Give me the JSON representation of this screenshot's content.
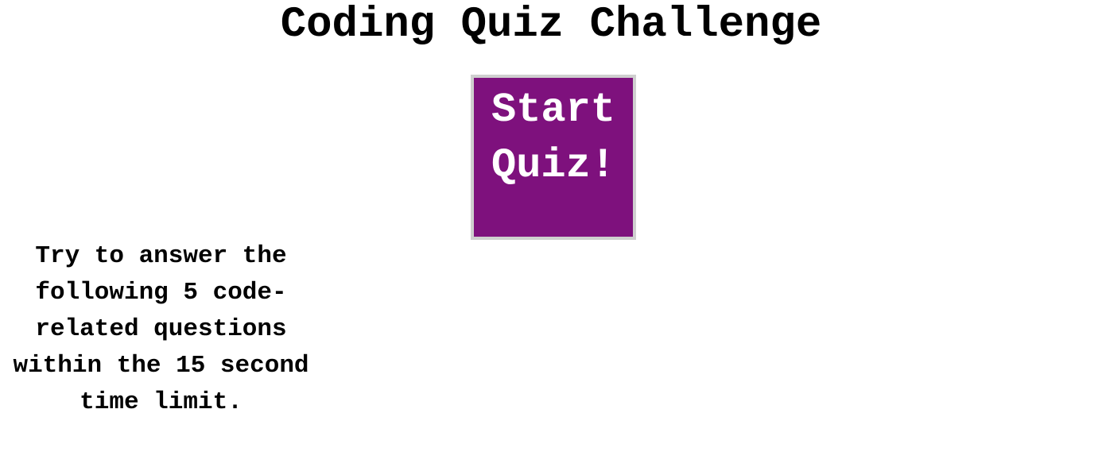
{
  "page": {
    "title": "Coding Quiz Challenge",
    "start_button_label": "Start Quiz!",
    "instructions": "Try to answer the following 5 code-related questions within the 15 second time limit."
  },
  "colors": {
    "button_background": "#7e117d",
    "button_border": "#cfcfcf",
    "button_text": "#ffffff",
    "text": "#000000",
    "background": "#ffffff"
  }
}
